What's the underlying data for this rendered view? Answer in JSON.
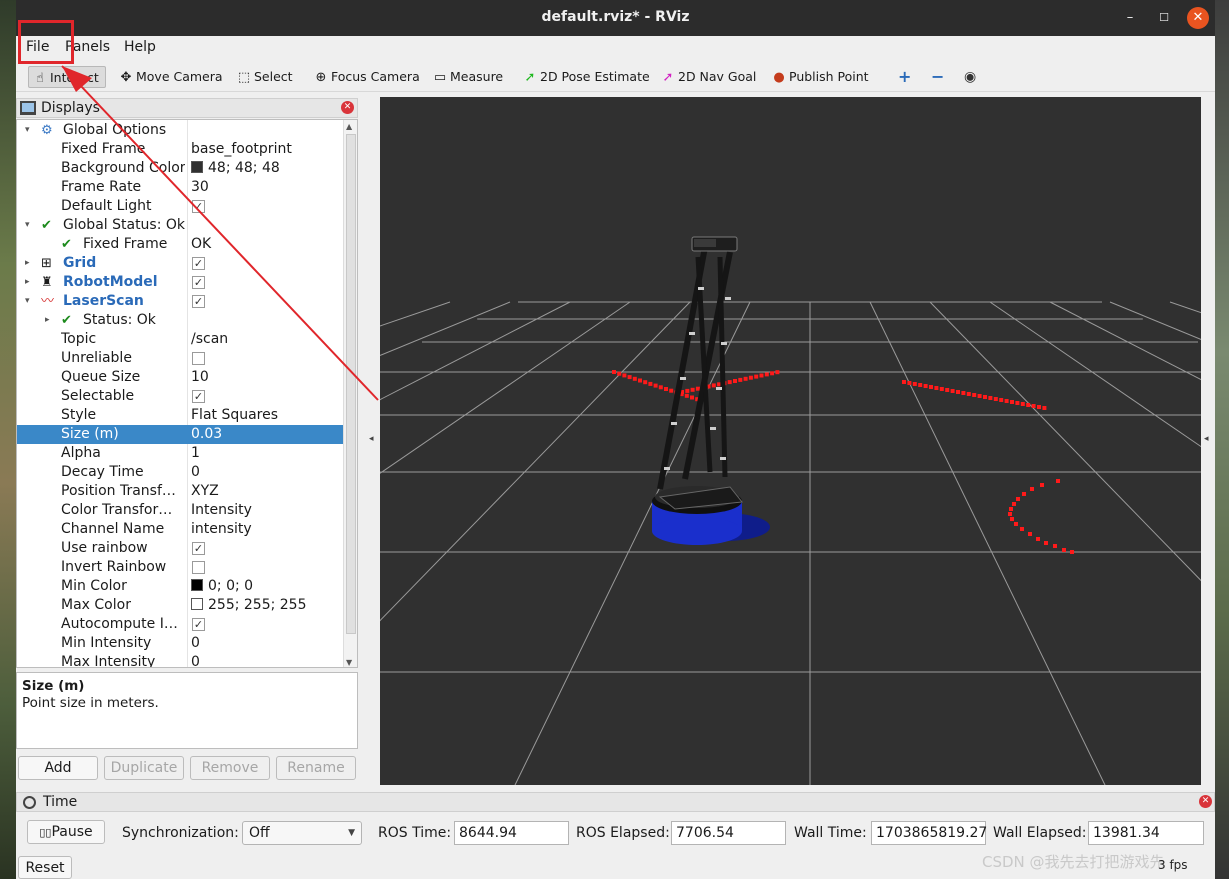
{
  "window": {
    "title": "default.rviz* - RViz",
    "min_glyph": "–",
    "max_glyph": "☐",
    "close_glyph": "✕"
  },
  "menu": [
    {
      "label": "File",
      "hint": "F"
    },
    {
      "label": "Panels",
      "hint": "P"
    },
    {
      "label": "Help",
      "hint": "H"
    }
  ],
  "toolbar": {
    "tools": [
      {
        "label": "Interact",
        "icon": "hand-icon",
        "glyph": "☝",
        "active": true
      },
      {
        "label": "Move Camera",
        "icon": "move-camera-icon",
        "glyph": "✥"
      },
      {
        "label": "Select",
        "icon": "select-icon",
        "glyph": "⬚"
      },
      {
        "label": "Focus Camera",
        "icon": "focus-camera-icon",
        "glyph": "⊕"
      },
      {
        "label": "Measure",
        "icon": "ruler-icon",
        "glyph": "▭"
      },
      {
        "label": "2D Pose Estimate",
        "icon": "pose-estimate-icon",
        "glyph": "➚",
        "color": "#1fb81f"
      },
      {
        "label": "2D Nav Goal",
        "icon": "nav-goal-icon",
        "glyph": "➚",
        "color": "#d21fc2"
      },
      {
        "label": "Publish Point",
        "icon": "map-pin-icon",
        "glyph": "●",
        "color": "#c43c1c"
      }
    ],
    "plus_glyph": "+",
    "minus_glyph": "−",
    "eye_glyph": "◉"
  },
  "displays": {
    "title": "Displays",
    "rows": [
      {
        "depth": 0,
        "expand": "▾",
        "icon": "gear-icon",
        "icon_glyph": "⚙",
        "name": "Global Options",
        "value": ""
      },
      {
        "depth": 1,
        "name": "Fixed Frame",
        "value": "base_footprint"
      },
      {
        "depth": 1,
        "name": "Background Color",
        "value": "48; 48; 48",
        "swatch": "#303030"
      },
      {
        "depth": 1,
        "name": "Frame Rate",
        "value": "30"
      },
      {
        "depth": 1,
        "name": "Default Light",
        "checkbox": true
      },
      {
        "depth": 0,
        "expand": "▾",
        "icon": "checkmark-icon",
        "icon_glyph": "✔",
        "name": "Global Status: Ok",
        "value": ""
      },
      {
        "depth": 1,
        "icon": "checkmark-icon",
        "icon_glyph": "✔",
        "name": "Fixed Frame",
        "value": "OK"
      },
      {
        "depth": 0,
        "expand": "▸",
        "icon": "grid-icon",
        "icon_glyph": "⊞",
        "name": "Grid",
        "checkbox": true,
        "blue": true
      },
      {
        "depth": 0,
        "expand": "▸",
        "icon": "robot-model-icon",
        "icon_glyph": "♜",
        "name": "RobotModel",
        "checkbox": true,
        "blue": true
      },
      {
        "depth": 0,
        "expand": "▾",
        "icon": "laser-scan-icon",
        "icon_glyph": "〰",
        "name": "LaserScan",
        "checkbox": true,
        "blue": true
      },
      {
        "depth": 1,
        "expand": "▸",
        "icon": "checkmark-icon",
        "icon_glyph": "✔",
        "name": "Status: Ok",
        "value": ""
      },
      {
        "depth": 1,
        "name": "Topic",
        "value": "/scan"
      },
      {
        "depth": 1,
        "name": "Unreliable",
        "checkbox": false
      },
      {
        "depth": 1,
        "name": "Queue Size",
        "value": "10"
      },
      {
        "depth": 1,
        "name": "Selectable",
        "checkbox": true
      },
      {
        "depth": 1,
        "name": "Style",
        "value": "Flat Squares"
      },
      {
        "depth": 1,
        "name": "Size (m)",
        "value": "0.03",
        "selected": true
      },
      {
        "depth": 1,
        "name": "Alpha",
        "value": "1"
      },
      {
        "depth": 1,
        "name": "Decay Time",
        "value": "0"
      },
      {
        "depth": 1,
        "name": "Position Transf…",
        "value": "XYZ"
      },
      {
        "depth": 1,
        "name": "Color Transfor…",
        "value": "Intensity"
      },
      {
        "depth": 1,
        "name": "Channel Name",
        "value": "intensity"
      },
      {
        "depth": 1,
        "name": "Use rainbow",
        "checkbox": true
      },
      {
        "depth": 1,
        "name": "Invert Rainbow",
        "checkbox": false
      },
      {
        "depth": 1,
        "name": "Min Color",
        "value": "0; 0; 0",
        "swatch": "#000000"
      },
      {
        "depth": 1,
        "name": "Max Color",
        "value": "255; 255; 255",
        "swatch": "#ffffff"
      },
      {
        "depth": 1,
        "name": "Autocompute I…",
        "checkbox": true
      },
      {
        "depth": 1,
        "name": "Min Intensity",
        "value": "0"
      },
      {
        "depth": 1,
        "name": "Max Intensity",
        "value": "0"
      }
    ],
    "description": {
      "title": "Size (m)",
      "body": "Point size in meters."
    },
    "buttons": [
      {
        "label": "Add",
        "enabled": true
      },
      {
        "label": "Duplicate",
        "enabled": false
      },
      {
        "label": "Remove",
        "enabled": false
      },
      {
        "label": "Rename",
        "enabled": false
      }
    ]
  },
  "time_panel": {
    "title": "Time",
    "pause_label": "Pause",
    "sync_label": "Synchronization:",
    "sync_value": "Off",
    "ros_time_label": "ROS Time:",
    "ros_time": "8644.94",
    "ros_elapsed_label": "ROS Elapsed:",
    "ros_elapsed": "7706.54",
    "wall_time_label": "Wall Time:",
    "wall_time": "1703865819.27",
    "wall_elapsed_label": "Wall Elapsed:",
    "wall_elapsed": "13981.34",
    "reset_label": "Reset",
    "fps": "3 fps"
  },
  "watermark": "CSDN @我先去打把游戏先",
  "colors": {
    "background": "#303030",
    "grid": "#a0a0a0",
    "laser_points": "#ff1a1a",
    "robot_base": "#1a2fcc",
    "selection": "#3a88c8",
    "annotation": "#e0262b"
  }
}
